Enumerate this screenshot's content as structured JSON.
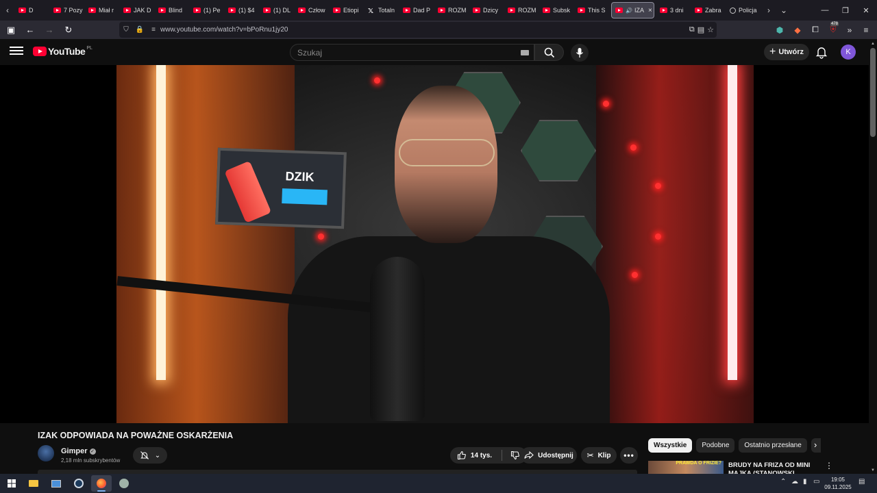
{
  "browser": {
    "tabs": [
      {
        "label": "D",
        "icon": "youtube-icon"
      },
      {
        "label": "7 Pozy",
        "icon": "youtube-icon"
      },
      {
        "label": "Miał r",
        "icon": "youtube-icon"
      },
      {
        "label": "JAK D",
        "icon": "youtube-icon"
      },
      {
        "label": "Blind",
        "icon": "youtube-icon"
      },
      {
        "label": "(1) Pe",
        "icon": "youtube-icon"
      },
      {
        "label": "(1) $4",
        "icon": "youtube-icon"
      },
      {
        "label": "(1) DL",
        "icon": "youtube-icon"
      },
      {
        "label": "Człow",
        "icon": "youtube-icon"
      },
      {
        "label": "Etiopi",
        "icon": "youtube-icon"
      },
      {
        "label": "Totaln",
        "icon": "x-icon"
      },
      {
        "label": "Dad P",
        "icon": "youtube-icon"
      },
      {
        "label": "ROZM",
        "icon": "youtube-icon"
      },
      {
        "label": "Dzicy",
        "icon": "youtube-icon"
      },
      {
        "label": "ROZM",
        "icon": "youtube-icon"
      },
      {
        "label": "Subsk",
        "icon": "youtube-icon"
      },
      {
        "label": "This S",
        "icon": "youtube-icon"
      }
    ],
    "active_tab": {
      "label": "IZA",
      "close": "×"
    },
    "tabs_after": [
      {
        "label": "3 dni",
        "icon": "youtube-icon"
      },
      {
        "label": "Zabra",
        "icon": "youtube-icon"
      },
      {
        "label": "Policja",
        "icon": "globe-icon"
      }
    ],
    "url": "www.youtube.com/watch?v=bPoRnu1jy20",
    "extension_badge": "478"
  },
  "youtube": {
    "logo_text": "YouTube",
    "country_code": "PL",
    "search_placeholder": "Szukaj",
    "create_label": "Utwórz",
    "avatar_letter": "K"
  },
  "video": {
    "title": "IZAK ODPOWIADA NA POWAŻNE OSKARŻENIA",
    "poster_brand": "DZIK"
  },
  "channel": {
    "name": "Gimper",
    "subscribers": "2,18 mln subskrybentów"
  },
  "actions": {
    "likes": "14 tys.",
    "share": "Udostępnij",
    "clip": "Klip"
  },
  "chips": [
    "Wszystkie",
    "Podobne",
    "Ostatnio przesłane"
  ],
  "recommendation": {
    "title": "BRUDY NA FRIZA OD MINI MAJKA (STANOWSKI",
    "thumb_overlay": "PRAWDA O FRIZIE?"
  },
  "taskbar": {
    "time": "19:05",
    "date": "09.11.2025"
  }
}
